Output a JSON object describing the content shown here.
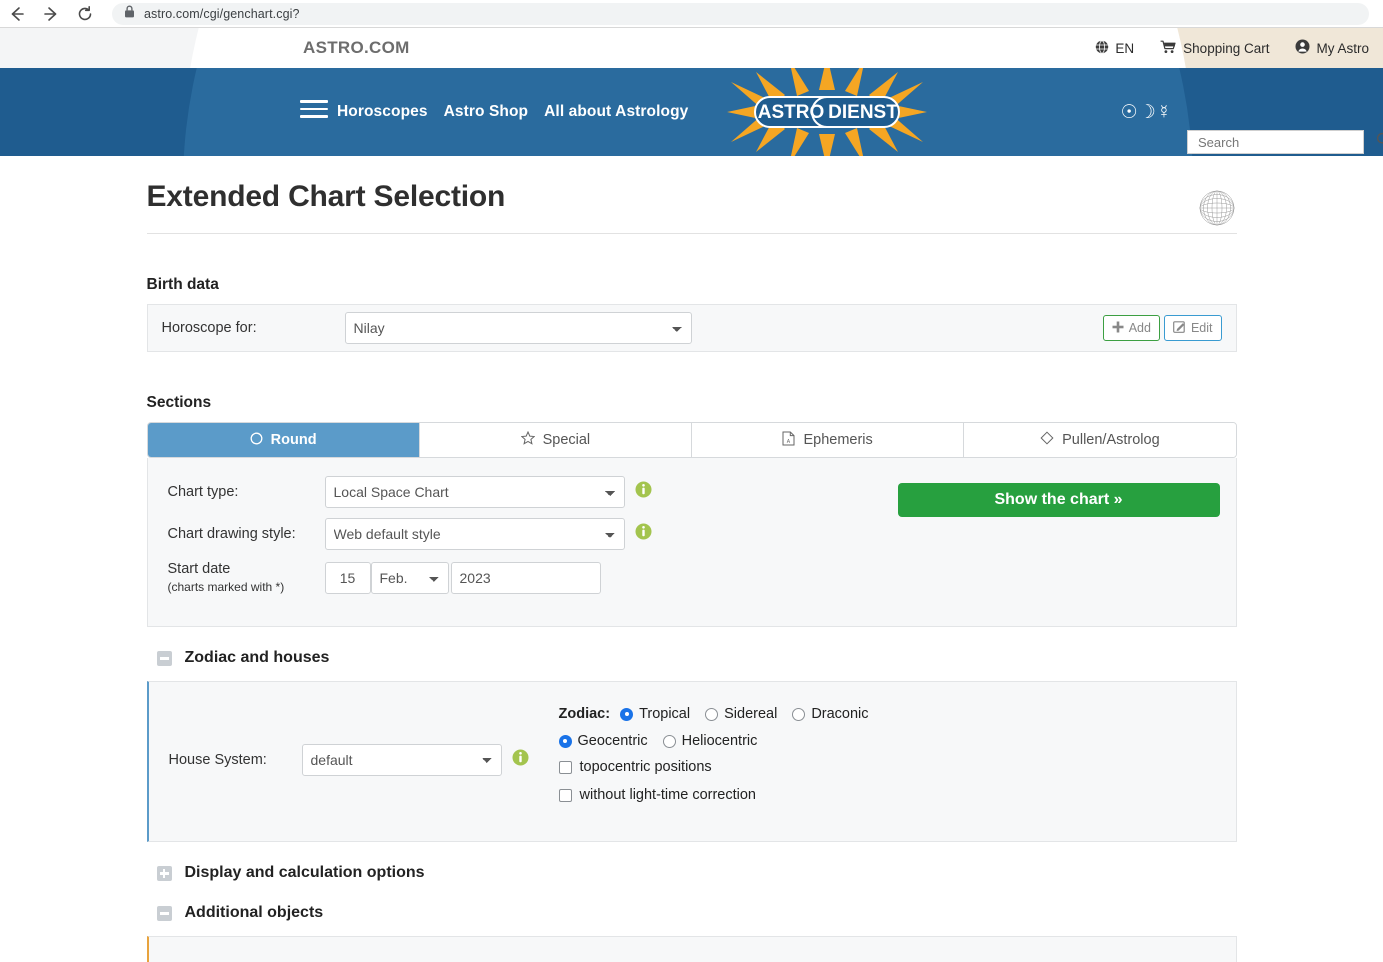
{
  "browser": {
    "url": "astro.com/cgi/genchart.cgi?",
    "back_label": "Back",
    "forward_label": "Forward",
    "reload_label": "Reload"
  },
  "topbar": {
    "brand": "ASTRO.COM",
    "language": "EN",
    "shopping_cart": "Shopping Cart",
    "my_astro": "My Astro"
  },
  "nav": {
    "links": [
      {
        "label": "Horoscopes"
      },
      {
        "label": "Astro Shop"
      },
      {
        "label": "All about Astrology"
      }
    ],
    "logo_left": "ASTRO",
    "logo_right": "DIENST",
    "planet_symbols": "☉☽☿",
    "search_placeholder": "Search",
    "search_value": ""
  },
  "page": {
    "title": "Extended Chart Selection"
  },
  "birth_data": {
    "heading": "Birth data",
    "horoscope_for_label": "Horoscope for:",
    "horoscope_for_value": "Nilay",
    "add_label": "Add",
    "edit_label": "Edit"
  },
  "sections": {
    "heading": "Sections",
    "tabs": [
      {
        "label": "Round",
        "icon": "circle-icon",
        "active": true
      },
      {
        "label": "Special",
        "icon": "star-icon",
        "active": false
      },
      {
        "label": "Ephemeris",
        "icon": "document-icon",
        "active": false
      },
      {
        "label": "Pullen/Astrolog",
        "icon": "diamond-icon",
        "active": false
      }
    ]
  },
  "chart_options": {
    "chart_type_label": "Chart type:",
    "chart_type_value": "Local Space Chart",
    "chart_style_label": "Chart drawing style:",
    "chart_style_value": "Web default style",
    "start_date_label": "Start date",
    "start_date_note": "(charts marked with *)",
    "day": "15",
    "month": "Feb.",
    "year": "2023",
    "show_chart_label": "Show the chart »"
  },
  "zodiac_houses": {
    "heading": "Zodiac and houses",
    "expanded": true,
    "house_system_label": "House System:",
    "house_system_value": "default",
    "zodiac_label": "Zodiac:",
    "zodiac_options": [
      {
        "label": "Tropical",
        "selected": true
      },
      {
        "label": "Sidereal",
        "selected": false
      },
      {
        "label": "Draconic",
        "selected": false
      }
    ],
    "center_options": [
      {
        "label": "Geocentric",
        "selected": true
      },
      {
        "label": "Heliocentric",
        "selected": false
      }
    ],
    "checkboxes": [
      {
        "label": "topocentric positions",
        "checked": false
      },
      {
        "label": "without light-time correction",
        "checked": false
      }
    ]
  },
  "collapsibles": [
    {
      "label": "Display and calculation options",
      "expanded": false
    },
    {
      "label": "Additional objects",
      "expanded": true
    }
  ],
  "colors": {
    "nav_blue": "#1f5c8f",
    "nav_circle_blue": "#2a6b9e",
    "tab_active_blue": "#5b9bc9",
    "button_green": "#27a03f",
    "radio_blue": "#1a73e8",
    "accent_orange": "#e8a33d",
    "logo_orange": "#f5a623",
    "topbar_beige": "#f0e7d8"
  }
}
